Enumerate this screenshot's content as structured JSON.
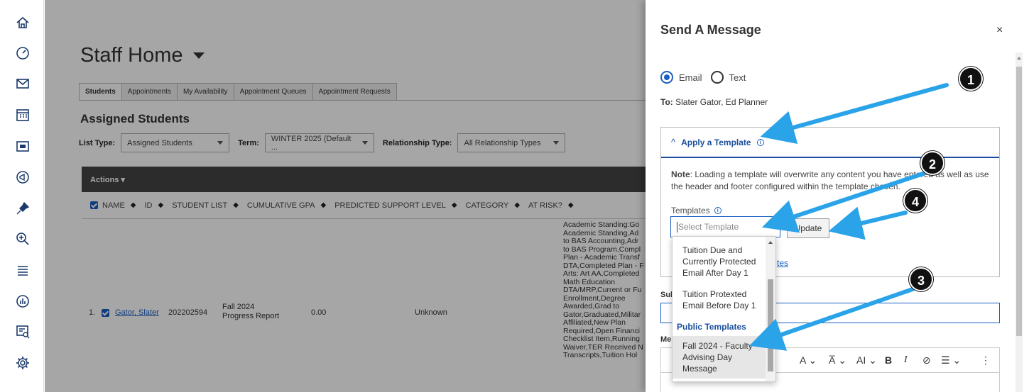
{
  "rail": {
    "icons": [
      "home-icon",
      "dashboard-icon",
      "mail-icon",
      "calendar-icon",
      "folder-icon",
      "megaphone-icon",
      "pin-icon",
      "search-zoom-icon",
      "list-icon",
      "reports-icon",
      "chat-search-icon",
      "settings-icon"
    ]
  },
  "main": {
    "title": "Staff Home",
    "tabs": [
      "Students",
      "Appointments",
      "My Availability",
      "Appointment Queues",
      "Appointment Requests"
    ],
    "section_title": "Assigned Students",
    "filters": {
      "list_type_label": "List Type:",
      "list_type_value": "Assigned Students",
      "term_label": "Term:",
      "term_value": "WINTER 2025 (Default ...",
      "relationship_label": "Relationship Type:",
      "relationship_value": "All Relationship Types"
    },
    "grid": {
      "actions_label": "Actions ▾",
      "columns": [
        "NAME",
        "ID",
        "STUDENT LIST",
        "CUMULATIVE GPA",
        "PREDICTED SUPPORT LEVEL",
        "CATEGORY",
        "AT RISK?"
      ],
      "row": {
        "index": "1.",
        "name": "Gator, Slater",
        "id": "202202594",
        "student_list": "Fall 2024 Progress Report",
        "gpa": "0.00",
        "support_level": "Unknown",
        "category_lines": [
          "Academic Standing:Go",
          "Academic Standing,Ad",
          "to BAS Accounting,Adr",
          "to BAS Program,Compl",
          "Plan - Academic Transf",
          "DTA,Completed Plan - F",
          "Arts: Art AA,Completed",
          "Math Education",
          "DTA/MRP,Current or Fu",
          "Enrollment,Degree",
          "Awarded,Grad to",
          "Gator,Graduated,Militar",
          "Affiliated,New Plan",
          "Required,Open Financi",
          "Checklist Item,Running",
          "Waiver,TER Received N",
          "Transcripts,Tuition Hol"
        ]
      }
    }
  },
  "drawer": {
    "title": "Send A Message",
    "close": "×",
    "radio_email": "Email",
    "radio_text": "Text",
    "to_label": "To:",
    "to_value": "Slater Gator, Ed Planner",
    "template_header": "Apply a Template",
    "note_bold": "Note",
    "note_text": ": Loading a template will overwrite any content you have entered as well as use the header and footer configured within the template chosen.",
    "templates_label": "Templates",
    "select_placeholder": "Select Template",
    "update_label": "Update",
    "link_partial": "tes",
    "subject_label": "Sub",
    "message_label": "Me",
    "editor_tools": [
      "A ⌄",
      "A̅ ⌄",
      "AI ⌄",
      "B",
      "I",
      "⊘",
      "☰ ⌄",
      "⋮"
    ]
  },
  "dropdown": {
    "items": [
      {
        "label": "Tuition Due and Currently Protected Email After Day 1"
      },
      {
        "label": "Tuition Protexted Email Before Day 1"
      }
    ],
    "group_label": "Public Templates",
    "public_items": [
      {
        "label": "Fall 2024 - Faculty Advising Day Message"
      }
    ]
  },
  "annotations": {
    "badges": [
      "1",
      "2",
      "3",
      "4"
    ],
    "arrow_color": "#2aa3e8"
  }
}
